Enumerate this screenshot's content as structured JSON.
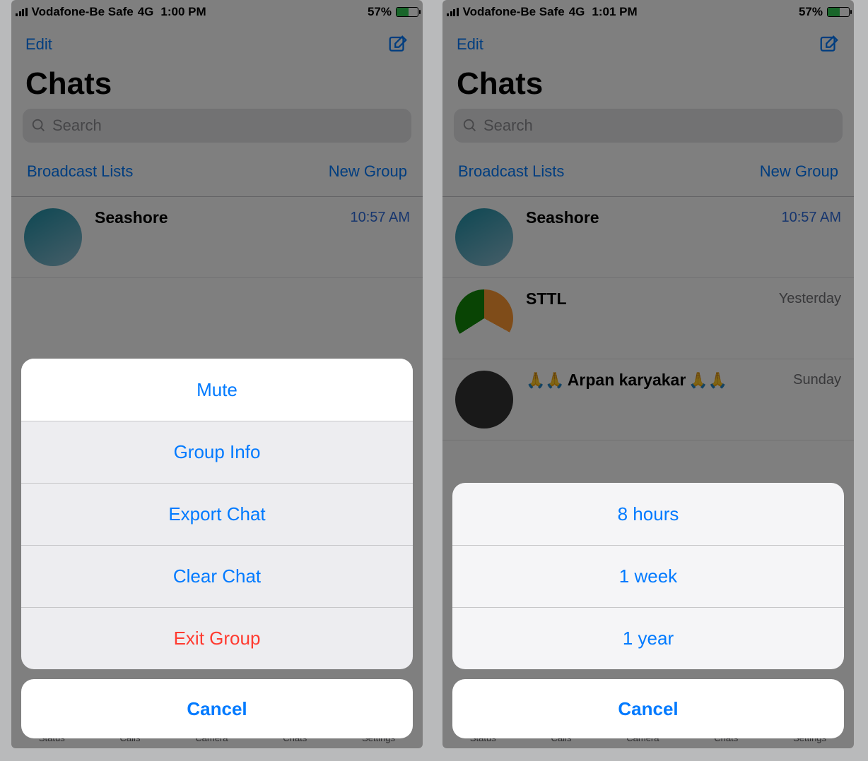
{
  "left": {
    "status": {
      "carrier": "Vodafone-Be Safe",
      "network": "4G",
      "time": "1:00 PM",
      "battery_pct": "57%"
    },
    "nav": {
      "edit": "Edit"
    },
    "title": "Chats",
    "search_placeholder": "Search",
    "section": {
      "broadcast": "Broadcast Lists",
      "newgroup": "New Group"
    },
    "chats": [
      {
        "name": "Seashore",
        "time": "10:57 AM"
      }
    ],
    "tabs": [
      "Status",
      "Calls",
      "Camera",
      "Chats",
      "Settings"
    ],
    "sheet": {
      "items": [
        {
          "key": "mute",
          "label": "Mute",
          "highlight": true,
          "destructive": false
        },
        {
          "key": "info",
          "label": "Group Info",
          "highlight": false,
          "destructive": false
        },
        {
          "key": "export",
          "label": "Export Chat",
          "highlight": false,
          "destructive": false
        },
        {
          "key": "clear",
          "label": "Clear Chat",
          "highlight": false,
          "destructive": false
        },
        {
          "key": "exit",
          "label": "Exit Group",
          "highlight": false,
          "destructive": true
        }
      ],
      "cancel": "Cancel"
    }
  },
  "right": {
    "status": {
      "carrier": "Vodafone-Be Safe",
      "network": "4G",
      "time": "1:01 PM",
      "battery_pct": "57%"
    },
    "nav": {
      "edit": "Edit"
    },
    "title": "Chats",
    "search_placeholder": "Search",
    "section": {
      "broadcast": "Broadcast Lists",
      "newgroup": "New Group"
    },
    "chats": [
      {
        "name": "Seashore",
        "time": "10:57 AM"
      },
      {
        "name": "STTL",
        "time": "Yesterday"
      },
      {
        "name": "Arpan karyakar",
        "time": "Sunday",
        "hands": true
      }
    ],
    "tabs": [
      "Status",
      "Calls",
      "Camera",
      "Chats",
      "Settings"
    ],
    "sheet": {
      "items": [
        {
          "key": "8h",
          "label": "8 hours"
        },
        {
          "key": "1w",
          "label": "1 week"
        },
        {
          "key": "1y",
          "label": "1 year"
        }
      ],
      "cancel": "Cancel"
    }
  }
}
